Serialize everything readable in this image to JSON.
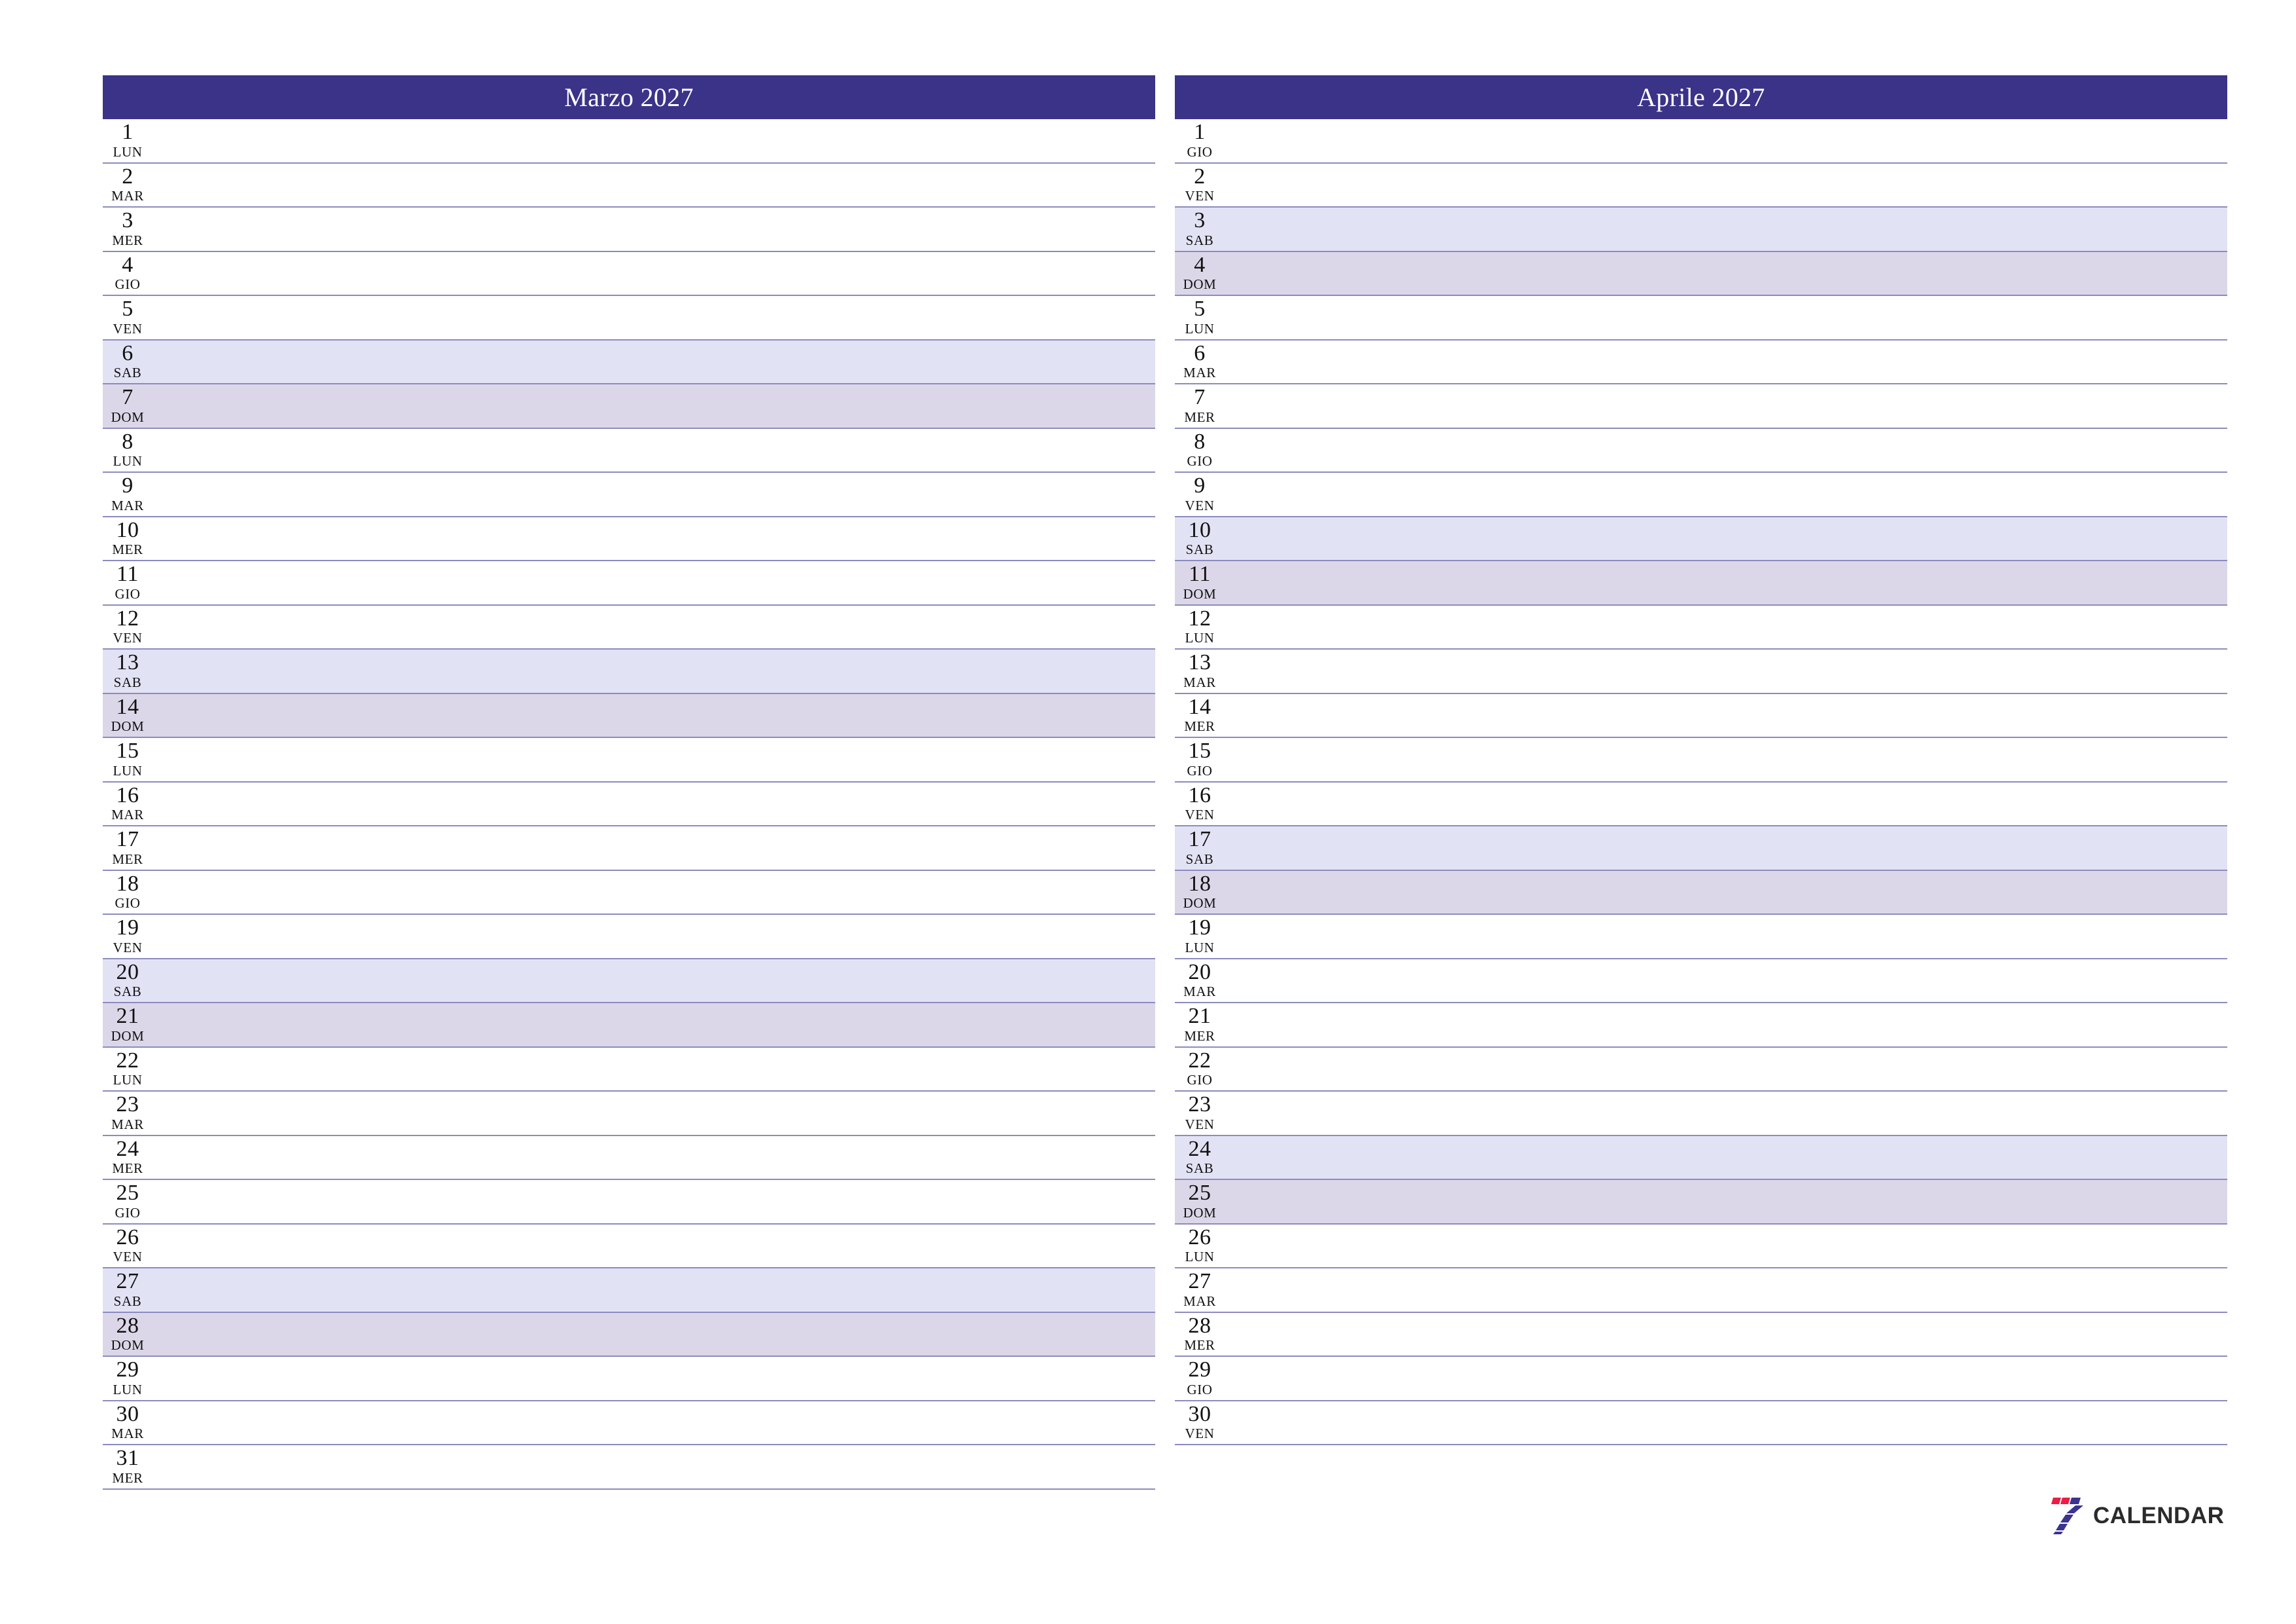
{
  "document": {
    "type": "two-month-planner",
    "language": "it"
  },
  "theme": {
    "header_bg": "#3b3388",
    "header_text": "#ffffff",
    "row_line": "#8b8bc0",
    "saturday_bg": "#e2e2f5",
    "sunday_bg": "#dcd7e8",
    "page_bg": "#ffffff",
    "logo_red": "#ec1c45",
    "logo_blue": "#3b3390",
    "logo_text": "#2b2b2b"
  },
  "months": [
    {
      "title": "Marzo 2027",
      "days": [
        {
          "num": "1",
          "abbr": "LUN",
          "kind": "weekday"
        },
        {
          "num": "2",
          "abbr": "MAR",
          "kind": "weekday"
        },
        {
          "num": "3",
          "abbr": "MER",
          "kind": "weekday"
        },
        {
          "num": "4",
          "abbr": "GIO",
          "kind": "weekday"
        },
        {
          "num": "5",
          "abbr": "VEN",
          "kind": "weekday"
        },
        {
          "num": "6",
          "abbr": "SAB",
          "kind": "sat"
        },
        {
          "num": "7",
          "abbr": "DOM",
          "kind": "sun"
        },
        {
          "num": "8",
          "abbr": "LUN",
          "kind": "weekday"
        },
        {
          "num": "9",
          "abbr": "MAR",
          "kind": "weekday"
        },
        {
          "num": "10",
          "abbr": "MER",
          "kind": "weekday"
        },
        {
          "num": "11",
          "abbr": "GIO",
          "kind": "weekday"
        },
        {
          "num": "12",
          "abbr": "VEN",
          "kind": "weekday"
        },
        {
          "num": "13",
          "abbr": "SAB",
          "kind": "sat"
        },
        {
          "num": "14",
          "abbr": "DOM",
          "kind": "sun"
        },
        {
          "num": "15",
          "abbr": "LUN",
          "kind": "weekday"
        },
        {
          "num": "16",
          "abbr": "MAR",
          "kind": "weekday"
        },
        {
          "num": "17",
          "abbr": "MER",
          "kind": "weekday"
        },
        {
          "num": "18",
          "abbr": "GIO",
          "kind": "weekday"
        },
        {
          "num": "19",
          "abbr": "VEN",
          "kind": "weekday"
        },
        {
          "num": "20",
          "abbr": "SAB",
          "kind": "sat"
        },
        {
          "num": "21",
          "abbr": "DOM",
          "kind": "sun"
        },
        {
          "num": "22",
          "abbr": "LUN",
          "kind": "weekday"
        },
        {
          "num": "23",
          "abbr": "MAR",
          "kind": "weekday"
        },
        {
          "num": "24",
          "abbr": "MER",
          "kind": "weekday"
        },
        {
          "num": "25",
          "abbr": "GIO",
          "kind": "weekday"
        },
        {
          "num": "26",
          "abbr": "VEN",
          "kind": "weekday"
        },
        {
          "num": "27",
          "abbr": "SAB",
          "kind": "sat"
        },
        {
          "num": "28",
          "abbr": "DOM",
          "kind": "sun"
        },
        {
          "num": "29",
          "abbr": "LUN",
          "kind": "weekday"
        },
        {
          "num": "30",
          "abbr": "MAR",
          "kind": "weekday"
        },
        {
          "num": "31",
          "abbr": "MER",
          "kind": "weekday"
        }
      ]
    },
    {
      "title": "Aprile 2027",
      "days": [
        {
          "num": "1",
          "abbr": "GIO",
          "kind": "weekday"
        },
        {
          "num": "2",
          "abbr": "VEN",
          "kind": "weekday"
        },
        {
          "num": "3",
          "abbr": "SAB",
          "kind": "sat"
        },
        {
          "num": "4",
          "abbr": "DOM",
          "kind": "sun"
        },
        {
          "num": "5",
          "abbr": "LUN",
          "kind": "weekday"
        },
        {
          "num": "6",
          "abbr": "MAR",
          "kind": "weekday"
        },
        {
          "num": "7",
          "abbr": "MER",
          "kind": "weekday"
        },
        {
          "num": "8",
          "abbr": "GIO",
          "kind": "weekday"
        },
        {
          "num": "9",
          "abbr": "VEN",
          "kind": "weekday"
        },
        {
          "num": "10",
          "abbr": "SAB",
          "kind": "sat"
        },
        {
          "num": "11",
          "abbr": "DOM",
          "kind": "sun"
        },
        {
          "num": "12",
          "abbr": "LUN",
          "kind": "weekday"
        },
        {
          "num": "13",
          "abbr": "MAR",
          "kind": "weekday"
        },
        {
          "num": "14",
          "abbr": "MER",
          "kind": "weekday"
        },
        {
          "num": "15",
          "abbr": "GIO",
          "kind": "weekday"
        },
        {
          "num": "16",
          "abbr": "VEN",
          "kind": "weekday"
        },
        {
          "num": "17",
          "abbr": "SAB",
          "kind": "sat"
        },
        {
          "num": "18",
          "abbr": "DOM",
          "kind": "sun"
        },
        {
          "num": "19",
          "abbr": "LUN",
          "kind": "weekday"
        },
        {
          "num": "20",
          "abbr": "MAR",
          "kind": "weekday"
        },
        {
          "num": "21",
          "abbr": "MER",
          "kind": "weekday"
        },
        {
          "num": "22",
          "abbr": "GIO",
          "kind": "weekday"
        },
        {
          "num": "23",
          "abbr": "VEN",
          "kind": "weekday"
        },
        {
          "num": "24",
          "abbr": "SAB",
          "kind": "sat"
        },
        {
          "num": "25",
          "abbr": "DOM",
          "kind": "sun"
        },
        {
          "num": "26",
          "abbr": "LUN",
          "kind": "weekday"
        },
        {
          "num": "27",
          "abbr": "MAR",
          "kind": "weekday"
        },
        {
          "num": "28",
          "abbr": "MER",
          "kind": "weekday"
        },
        {
          "num": "29",
          "abbr": "GIO",
          "kind": "weekday"
        },
        {
          "num": "30",
          "abbr": "VEN",
          "kind": "weekday"
        }
      ]
    }
  ],
  "logo": {
    "mark": "seven-logo-icon",
    "text": "CALENDAR"
  }
}
